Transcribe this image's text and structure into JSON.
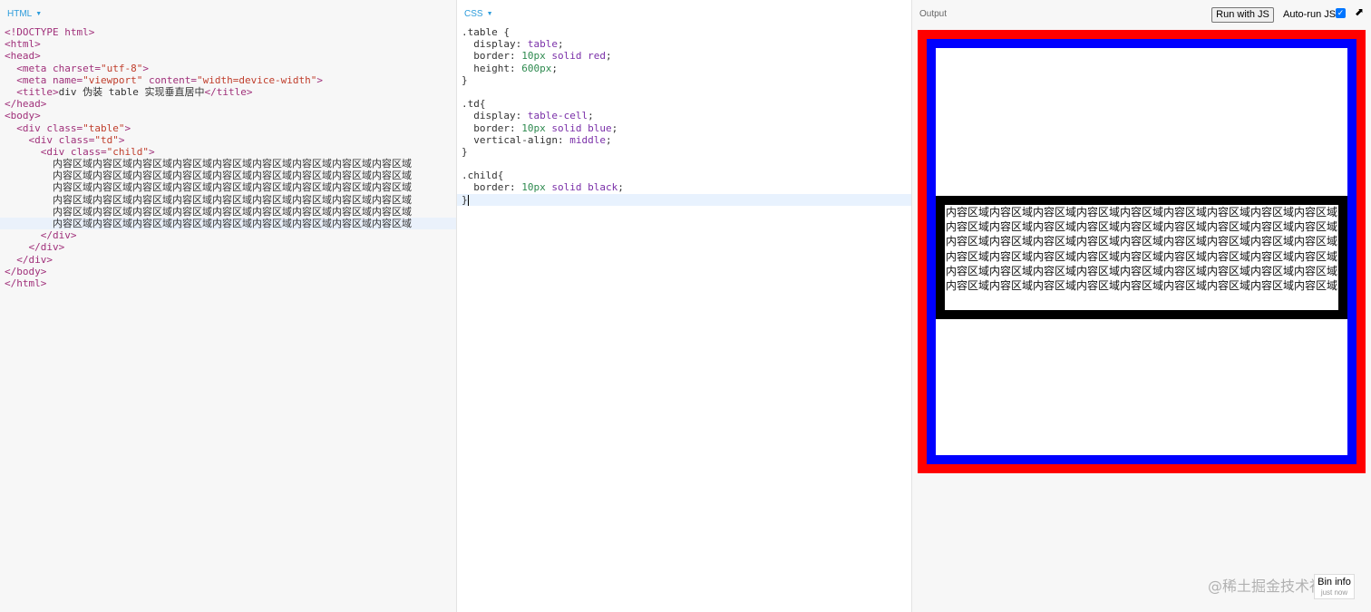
{
  "html_pane": {
    "label": "HTML",
    "code_lines": [
      [
        [
          "tg",
          "<!DOCTYPE html>"
        ]
      ],
      [
        [
          "tg",
          "<html>"
        ]
      ],
      [
        [
          "tg",
          "<head>"
        ]
      ],
      [
        [
          "tx",
          "  "
        ],
        [
          "tg",
          "<meta "
        ],
        [
          "an",
          "charset"
        ],
        [
          "tg",
          "="
        ],
        [
          "av",
          "\"utf-8\""
        ],
        [
          "tg",
          ">"
        ]
      ],
      [
        [
          "tx",
          "  "
        ],
        [
          "tg",
          "<meta "
        ],
        [
          "an",
          "name"
        ],
        [
          "tg",
          "="
        ],
        [
          "av",
          "\"viewport\""
        ],
        [
          "tx",
          " "
        ],
        [
          "an",
          "content"
        ],
        [
          "tg",
          "="
        ],
        [
          "av",
          "\"width=device-width\""
        ],
        [
          "tg",
          ">"
        ]
      ],
      [
        [
          "tx",
          "  "
        ],
        [
          "tg",
          "<title>"
        ],
        [
          "tx",
          "div 伪装 table 实现垂直居中"
        ],
        [
          "tg",
          "</title>"
        ]
      ],
      [
        [
          "tg",
          "</head>"
        ]
      ],
      [
        [
          "tg",
          "<body>"
        ]
      ],
      [
        [
          "tx",
          "  "
        ],
        [
          "tg",
          "<div "
        ],
        [
          "an",
          "class"
        ],
        [
          "tg",
          "="
        ],
        [
          "av",
          "\"table\""
        ],
        [
          "tg",
          ">"
        ]
      ],
      [
        [
          "tx",
          "    "
        ],
        [
          "tg",
          "<div "
        ],
        [
          "an",
          "class"
        ],
        [
          "tg",
          "="
        ],
        [
          "av",
          "\"td\""
        ],
        [
          "tg",
          ">"
        ]
      ],
      [
        [
          "tx",
          "      "
        ],
        [
          "tg",
          "<div "
        ],
        [
          "an",
          "class"
        ],
        [
          "tg",
          "="
        ],
        [
          "av",
          "\"child\""
        ],
        [
          "tg",
          ">"
        ]
      ],
      [
        [
          "tx",
          "        内容区域内容区域内容区域内容区域内容区域内容区域内容区域内容区域内容区域"
        ]
      ],
      [
        [
          "tx",
          "        内容区域内容区域内容区域内容区域内容区域内容区域内容区域内容区域内容区域"
        ]
      ],
      [
        [
          "tx",
          "        内容区域内容区域内容区域内容区域内容区域内容区域内容区域内容区域内容区域"
        ]
      ],
      [
        [
          "tx",
          "        内容区域内容区域内容区域内容区域内容区域内容区域内容区域内容区域内容区域"
        ]
      ],
      [
        [
          "tx",
          "        内容区域内容区域内容区域内容区域内容区域内容区域内容区域内容区域内容区域"
        ]
      ],
      [
        [
          "tx",
          "        内容区域内容区域内容区域内容区域内容区域内容区域内容区域内容区域内容区域"
        ]
      ],
      [
        [
          "tx",
          "      "
        ],
        [
          "tg",
          "</div>"
        ]
      ],
      [
        [
          "tx",
          "    "
        ],
        [
          "tg",
          "</div>"
        ]
      ],
      [
        [
          "tx",
          "  "
        ],
        [
          "tg",
          "</div>"
        ]
      ],
      [
        [
          "tg",
          "</body>"
        ]
      ],
      [
        [
          "tg",
          "</html>"
        ]
      ]
    ]
  },
  "css_pane": {
    "label": "CSS",
    "code_lines": [
      [
        [
          "sel",
          ".table {"
        ]
      ],
      [
        [
          "pr",
          "  display: "
        ],
        [
          "vl",
          "table"
        ],
        [
          "pr",
          ";"
        ]
      ],
      [
        [
          "pr",
          "  border: "
        ],
        [
          "nm",
          "10px"
        ],
        [
          "pr",
          " "
        ],
        [
          "vl",
          "solid red"
        ],
        [
          "pr",
          ";"
        ]
      ],
      [
        [
          "pr",
          "  height: "
        ],
        [
          "nm",
          "600px"
        ],
        [
          "pr",
          ";"
        ]
      ],
      [
        [
          "sel",
          "}"
        ]
      ],
      [
        [
          "tx",
          ""
        ]
      ],
      [
        [
          "sel",
          ".td{"
        ]
      ],
      [
        [
          "pr",
          "  display: "
        ],
        [
          "vl",
          "table-cell"
        ],
        [
          "pr",
          ";"
        ]
      ],
      [
        [
          "pr",
          "  border: "
        ],
        [
          "nm",
          "10px"
        ],
        [
          "pr",
          " "
        ],
        [
          "vl",
          "solid blue"
        ],
        [
          "pr",
          ";"
        ]
      ],
      [
        [
          "pr",
          "  vertical-align: "
        ],
        [
          "vl",
          "middle"
        ],
        [
          "pr",
          ";"
        ]
      ],
      [
        [
          "sel",
          "}"
        ]
      ],
      [
        [
          "tx",
          ""
        ]
      ],
      [
        [
          "sel",
          ".child{"
        ]
      ],
      [
        [
          "pr",
          "  border: "
        ],
        [
          "nm",
          "10px"
        ],
        [
          "pr",
          " "
        ],
        [
          "vl",
          "solid black"
        ],
        [
          "pr",
          ";"
        ]
      ],
      [
        [
          "sel",
          "}"
        ]
      ]
    ]
  },
  "output_pane": {
    "label": "Output",
    "run_button": "Run with JS",
    "autorun_label": "Auto-run JS",
    "autorun_checked": true,
    "child_text": "内容区域内容区域内容区域内容区域内容区域内容区域内容区域内容区域内容区域 内容区域内容区域内容区域内容区域内容区域内容区域内容区域内容区域内容区域 内容区域内容区域内容区域内容区域内容区域内容区域内容区域内容区域内容区域 内容区域内容区域内容区域内容区域内容区域内容区域内容区域内容区域内容区域 内容区域内容区域内容区域内容区域内容区域内容区域内容区域内容区域内容区域 内容区域内容区域内容区域内容区域内容区域内容区域内容区域内容区域内容区域"
  },
  "bin_info": {
    "title": "Bin info",
    "subtitle": "just now"
  },
  "watermark": "@稀土掘金技术社区",
  "colors": {
    "table_border": "#ff0000",
    "td_border": "#0000ff",
    "child_border": "#000000",
    "pane_label_accent": "#2d9cdb",
    "checkbox_accent": "#0075ff"
  }
}
